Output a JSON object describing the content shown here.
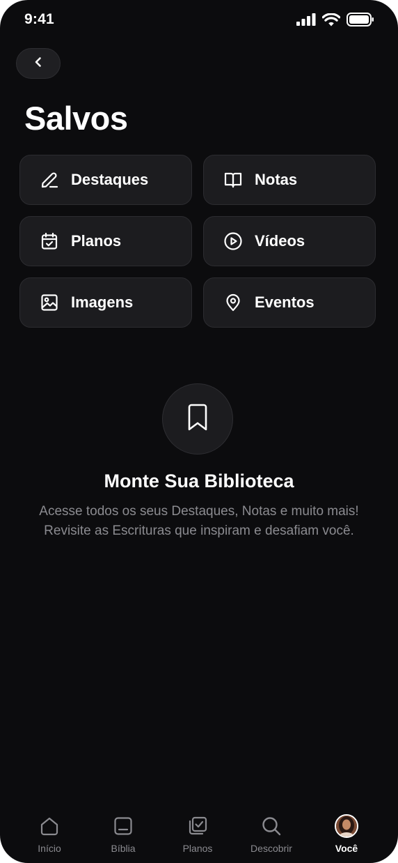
{
  "status_bar": {
    "time": "9:41",
    "icons": [
      "cellular-signal-icon",
      "wifi-icon",
      "battery-icon"
    ]
  },
  "header": {
    "back_icon": "chevron-left-icon",
    "title": "Salvos"
  },
  "saved_items": [
    {
      "label": "Destaques",
      "icon": "pen-icon"
    },
    {
      "label": "Notas",
      "icon": "open-book-icon"
    },
    {
      "label": "Planos",
      "icon": "calendar-check-icon"
    },
    {
      "label": "Vídeos",
      "icon": "play-circle-icon"
    },
    {
      "label": "Imagens",
      "icon": "image-icon"
    },
    {
      "label": "Eventos",
      "icon": "map-pin-icon"
    }
  ],
  "empty_state": {
    "icon": "bookmark-icon",
    "title": "Monte Sua Biblioteca",
    "description": "Acesse todos os seus Destaques, Notas e muito mais! Revisite as Escrituras que inspiram e desafiam você."
  },
  "bottom_nav": {
    "items": [
      {
        "label": "Início",
        "icon": "home-icon"
      },
      {
        "label": "Bíblia",
        "icon": "bible-icon"
      },
      {
        "label": "Planos",
        "icon": "plans-check-icon"
      },
      {
        "label": "Descobrir",
        "icon": "search-icon"
      },
      {
        "label": "Você",
        "icon": "avatar",
        "active": true
      }
    ]
  },
  "colors": {
    "background": "#0c0c0e",
    "tile": "#1c1c1f",
    "text_primary": "#ffffff",
    "text_secondary": "#8b8b90"
  }
}
